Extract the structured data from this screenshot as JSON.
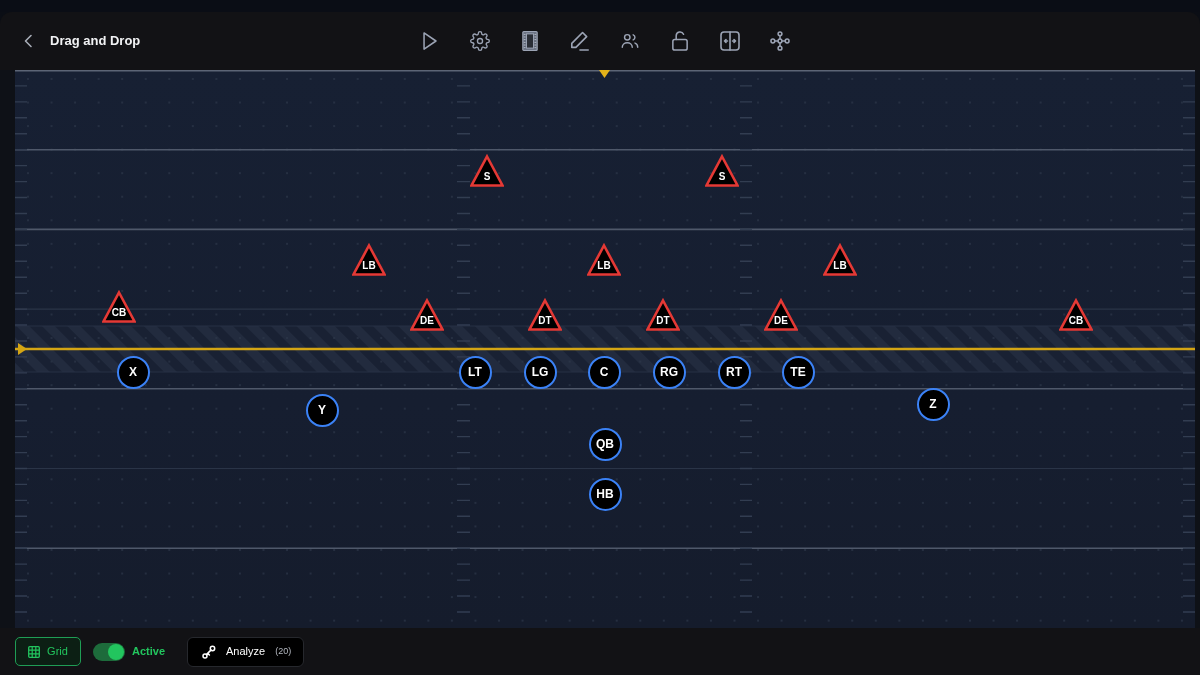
{
  "header": {
    "title": "Drag and Drop"
  },
  "field": {
    "players": [
      {
        "kind": "defense",
        "label": "S"
      },
      {
        "kind": "defense",
        "label": "S"
      },
      {
        "kind": "defense",
        "label": "LB"
      },
      {
        "kind": "defense",
        "label": "LB"
      },
      {
        "kind": "defense",
        "label": "LB"
      },
      {
        "kind": "defense",
        "label": "CB"
      },
      {
        "kind": "defense",
        "label": "DE"
      },
      {
        "kind": "defense",
        "label": "DT"
      },
      {
        "kind": "defense",
        "label": "DT"
      },
      {
        "kind": "defense",
        "label": "DE"
      },
      {
        "kind": "defense",
        "label": "CB"
      },
      {
        "kind": "offense",
        "label": "X"
      },
      {
        "kind": "offense",
        "label": "LT"
      },
      {
        "kind": "offense",
        "label": "LG"
      },
      {
        "kind": "offense",
        "label": "C"
      },
      {
        "kind": "offense",
        "label": "RG"
      },
      {
        "kind": "offense",
        "label": "RT"
      },
      {
        "kind": "offense",
        "label": "TE"
      },
      {
        "kind": "offense",
        "label": "Y"
      },
      {
        "kind": "offense",
        "label": "Z"
      },
      {
        "kind": "offense",
        "label": "QB"
      },
      {
        "kind": "offense",
        "label": "HB"
      }
    ]
  },
  "footer": {
    "grid_button": {
      "label": "Grid",
      "on": true
    },
    "active_toggle": {
      "label": "Active",
      "on": true
    },
    "analyze_button": {
      "label": "Analyze",
      "count": "(20)"
    }
  }
}
